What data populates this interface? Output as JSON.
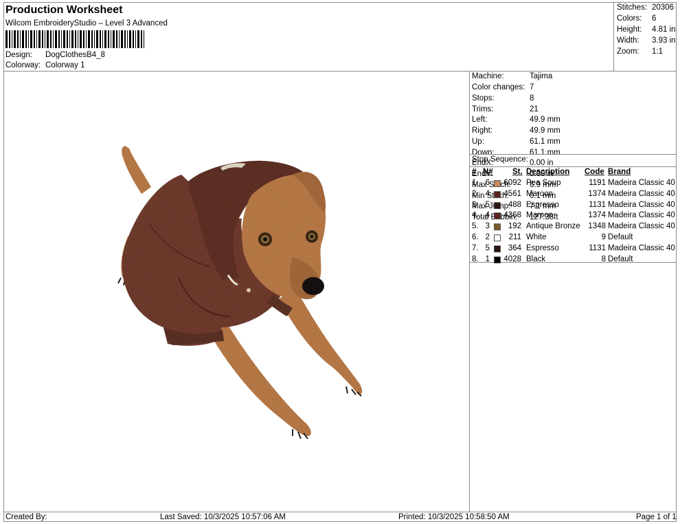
{
  "header": {
    "title": "Production Worksheet",
    "subtitle": "Wilcom EmbroideryStudio – Level 3 Advanced",
    "design_label": "Design:",
    "design_value": "DogClothesB4_8",
    "colorway_label": "Colorway:",
    "colorway_value": "Colorway 1"
  },
  "summary": [
    {
      "label": "Stitches:",
      "value": "20306"
    },
    {
      "label": "Colors:",
      "value": "6"
    },
    {
      "label": "Height:",
      "value": "4.81 in"
    },
    {
      "label": "Width:",
      "value": "3.93 in"
    },
    {
      "label": "Zoom:",
      "value": "1:1"
    }
  ],
  "machine_info": [
    {
      "label": "Machine:",
      "value": "Tajima"
    },
    {
      "label": "Color changes:",
      "value": "7"
    },
    {
      "label": "Stops:",
      "value": "8"
    },
    {
      "label": "Trims:",
      "value": "21"
    },
    {
      "label": "Left:",
      "value": "49.9 mm"
    },
    {
      "label": "Right:",
      "value": "49.9 mm"
    },
    {
      "label": "Up:",
      "value": "61.1 mm"
    },
    {
      "label": "Down:",
      "value": "61.1 mm"
    },
    {
      "label": "EndX:",
      "value": "0.00 in"
    },
    {
      "label": "EndY:",
      "value": "0.00 in"
    },
    {
      "label": "Max Stitch:",
      "value": "6.9 mm"
    },
    {
      "label": "Min Stitch:",
      "value": "0.1 mm"
    },
    {
      "label": "Max Jump:",
      "value": "7.1 mm"
    },
    {
      "label": "Total Bobbin:",
      "value": "127.38ft"
    }
  ],
  "stop_sequence": {
    "title": "Stop Sequence:",
    "headers": {
      "num": "#",
      "n": "N#",
      "st": "St.",
      "description": "Description",
      "code": "Code",
      "brand": "Brand"
    },
    "rows": [
      {
        "num": "1.",
        "n": "6",
        "color": "#c8855e",
        "st": "6092",
        "description": "Pea Soup",
        "code": "1191",
        "brand": "Madeira Classic 40"
      },
      {
        "num": "2.",
        "n": "4",
        "color": "#5a2320",
        "st": "4561",
        "description": "Maroon",
        "code": "1374",
        "brand": "Madeira Classic 40"
      },
      {
        "num": "3.",
        "n": "5",
        "color": "#2a1410",
        "st": "488",
        "description": "Espresso",
        "code": "1131",
        "brand": "Madeira Classic 40"
      },
      {
        "num": "4.",
        "n": "4",
        "color": "#5a2320",
        "st": "4368",
        "description": "Maroon",
        "code": "1374",
        "brand": "Madeira Classic 40"
      },
      {
        "num": "5.",
        "n": "3",
        "color": "#7a5a2a",
        "st": "192",
        "description": "Antique Bronze",
        "code": "1348",
        "brand": "Madeira Classic 40"
      },
      {
        "num": "6.",
        "n": "2",
        "color": "#ffffff",
        "st": "211",
        "description": "White",
        "code": "9",
        "brand": "Default"
      },
      {
        "num": "7.",
        "n": "5",
        "color": "#2a1410",
        "st": "364",
        "description": "Espresso",
        "code": "1131",
        "brand": "Madeira Classic 40"
      },
      {
        "num": "8.",
        "n": "1",
        "color": "#000000",
        "st": "4028",
        "description": "Black",
        "code": "8",
        "brand": "Default"
      }
    ]
  },
  "footer": {
    "created_by": "Created By:",
    "last_saved": "Last Saved: 10/3/2025 10:57:06 AM",
    "printed": "Printed: 10/3/2025 10:58:50 AM",
    "page": "Page 1 of 1"
  },
  "colors": {
    "hoodie": "#6e3a2c",
    "fur": "#b97a47",
    "fur_dark": "#7d4b28",
    "border": "#8a8a8a"
  }
}
